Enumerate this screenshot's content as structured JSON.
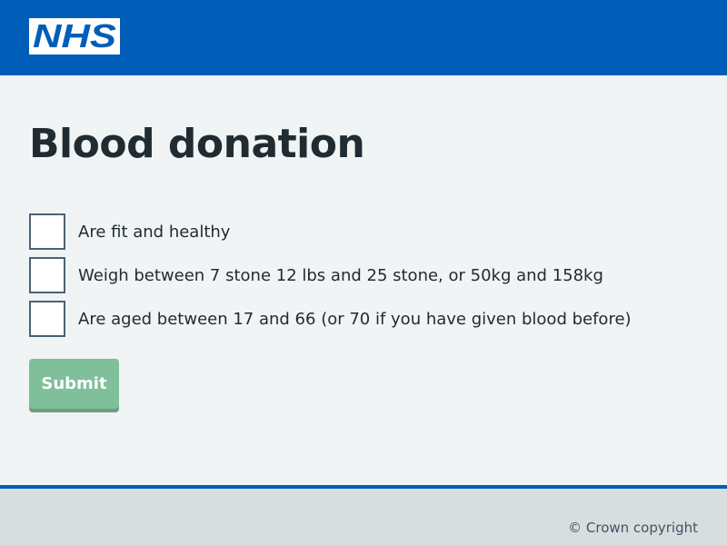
{
  "header": {
    "logo_text": "NHS",
    "logo_icon": "nhs-logo",
    "brand_color": "#005eb8"
  },
  "main": {
    "title": "Blood donation",
    "checkboxes": [
      {
        "label": "Are fit and healthy",
        "checked": false
      },
      {
        "label": "Weigh between 7 stone 12 lbs and 25 stone, or 50kg and 158kg",
        "checked": false
      },
      {
        "label": "Are aged between 17 and 66 (or 70 if you have given blood before)",
        "checked": false
      }
    ],
    "submit_label": "Submit",
    "submit_color": "#7fbf99"
  },
  "footer": {
    "copyright": "© Crown copyright"
  }
}
